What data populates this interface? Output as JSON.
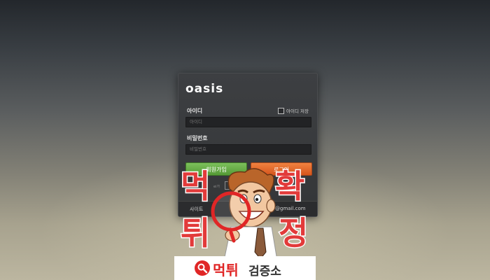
{
  "login": {
    "logo": "oasis",
    "id_label": "아이디",
    "save_id_label": "아이디 저장",
    "id_placeholder": "아이디",
    "password_label": "비밀번호",
    "password_placeholder": "비밀번호",
    "signup_button": "회원가입",
    "login_button": "로그인",
    "small_text": "ei가",
    "footer_left": "사이트",
    "footer_right": "@gmail.com"
  },
  "watermark": {
    "chars": [
      "먹",
      "확",
      "튀",
      "정"
    ],
    "banner_red": "먹튀",
    "banner_dark": "검증소"
  },
  "colors": {
    "signup": "#6bb04a",
    "login": "#e5672b",
    "watermark_red": "#e23a3a"
  },
  "icons": [
    "checkbox-icon",
    "mascot-magnifier-icon",
    "magnifier-icon"
  ]
}
